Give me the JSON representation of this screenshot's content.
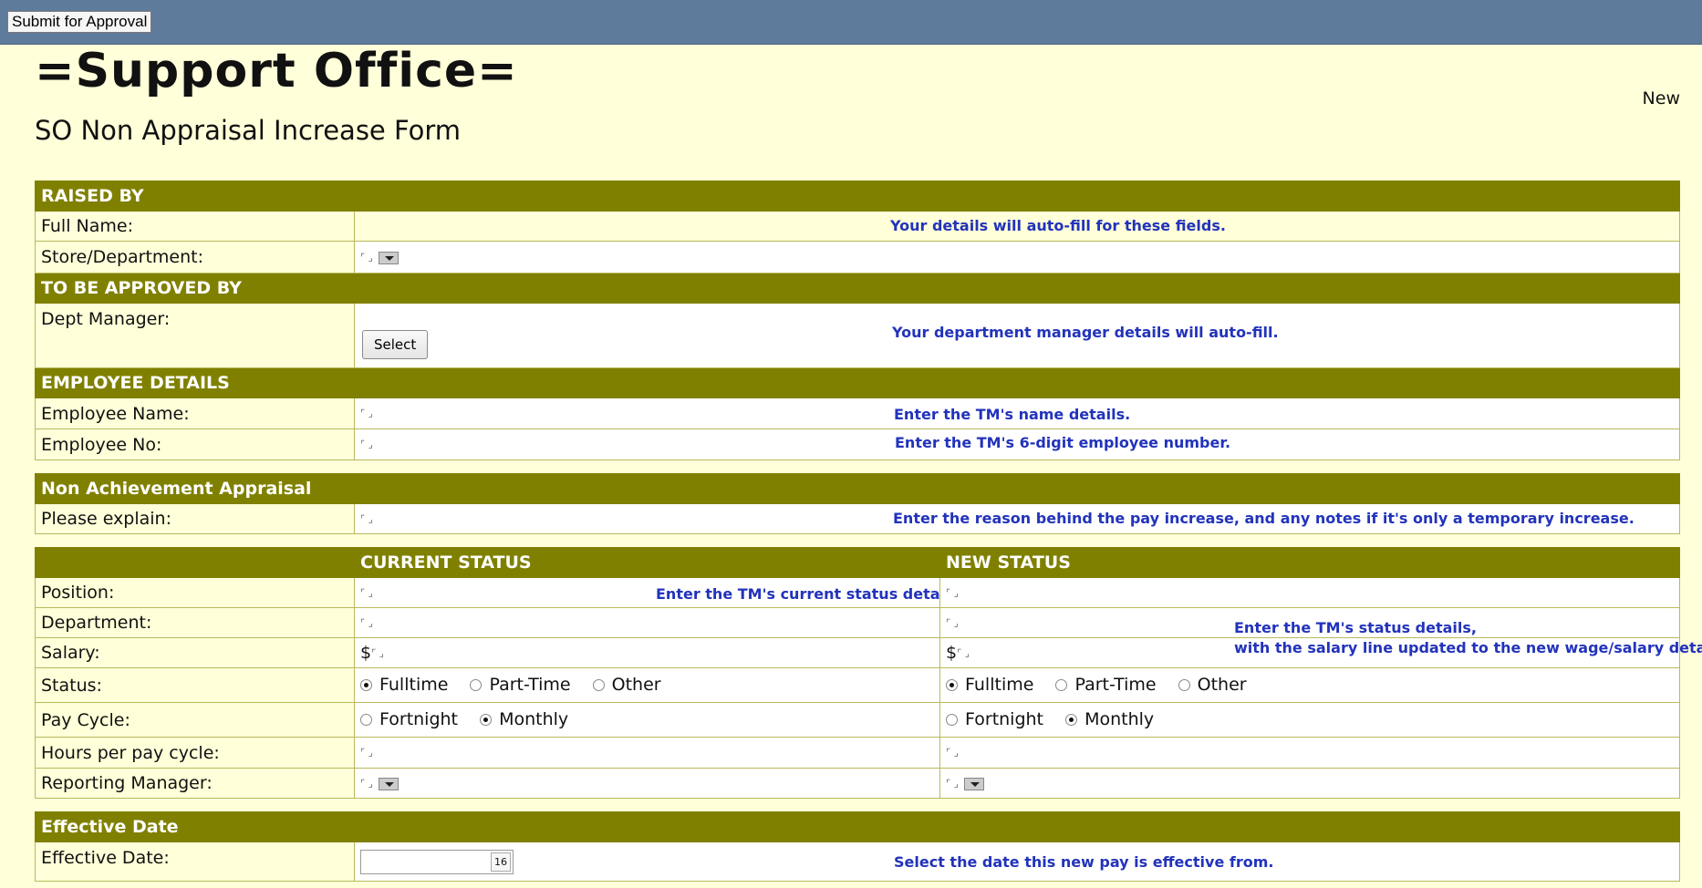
{
  "toolbar": {
    "submit_label": "Submit for Approval"
  },
  "header": {
    "title": "=Support Office=",
    "form_title": "SO Non Appraisal Increase Form",
    "status": "New"
  },
  "raised_by": {
    "heading": "RAISED BY",
    "full_name_label": "Full Name:",
    "store_label": "Store/Department:",
    "hint": "Your details will auto-fill for these fields."
  },
  "approval": {
    "heading": "TO BE APPROVED BY",
    "manager_label": "Dept Manager:",
    "select_label": "Select",
    "hint": "Your department manager details will auto-fill."
  },
  "employee": {
    "heading": "EMPLOYEE DETAILS",
    "name_label": "Employee Name:",
    "number_label": "Employee No:",
    "name_hint": "Enter the TM's name details.",
    "number_hint": "Enter the TM's 6-digit employee number."
  },
  "non_achievement": {
    "heading": "Non Achievement Appraisal",
    "explain_label": "Please explain:",
    "hint": "Enter the reason behind the pay increase, and any notes if it's only a temporary increase."
  },
  "status": {
    "current_heading": "CURRENT STATUS",
    "new_heading": "NEW STATUS",
    "position_label": "Position:",
    "department_label": "Department:",
    "salary_label": "Salary:",
    "status_label": "Status:",
    "pay_cycle_label": "Pay Cycle:",
    "hours_label": "Hours per pay cycle:",
    "reporting_label": "Reporting Manager:",
    "currency": "$",
    "status_options": [
      "Fulltime",
      "Part-Time",
      "Other"
    ],
    "current_status_selected": "Fulltime",
    "new_status_selected": "Fulltime",
    "pay_cycle_options": [
      "Fortnight",
      "Monthly"
    ],
    "current_pay_cycle_selected": "Monthly",
    "new_pay_cycle_selected": "Monthly",
    "current_hint": "Enter the TM's current status details.",
    "new_hint_line1": "Enter the TM's status details,",
    "new_hint_line2": "with the salary line updated to the new wage/salary details."
  },
  "effective": {
    "heading": "Effective Date",
    "label": "Effective Date:",
    "calendar_text": "16",
    "hint": "Select the date this new pay is effective from."
  }
}
